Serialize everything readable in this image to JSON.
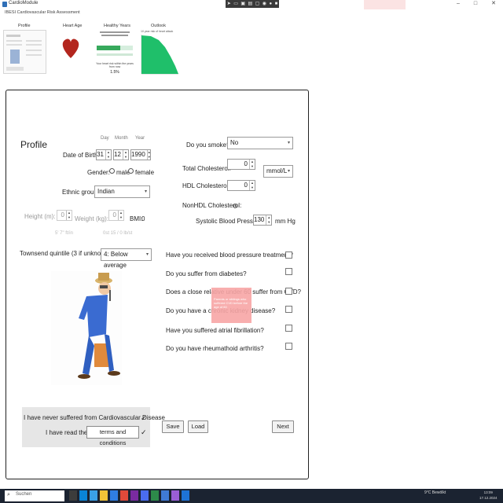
{
  "titlebar": {
    "app_title": "CardioModule",
    "toolbar_icons": [
      "cursor-icon",
      "window-icon",
      "highlight-icon",
      "folder-icon",
      "window-icon",
      "record-icon",
      "circle-icon",
      "stop-icon"
    ],
    "window_controls": {
      "minimize": "–",
      "maximize": "□",
      "close": "✕"
    }
  },
  "subtitle": "IBESI Cardiovascular Risk Assessment",
  "nav_tabs": [
    {
      "label": "Profile"
    },
    {
      "label": "Heart Age"
    },
    {
      "label": "Healthy Years"
    },
    {
      "label": "Outlook"
    }
  ],
  "thumb_healthy_years": {
    "desc": "Your heart risk within the years from now",
    "percent": "1.5%"
  },
  "thumb_outlook_title": "10 year risk of heart attack",
  "profile": {
    "heading": "Profile",
    "dob": {
      "label": "Date of Birth",
      "day_label": "Day",
      "month_label": "Month",
      "year_label": "Year",
      "day": "31",
      "month": "12",
      "year": "1990"
    },
    "gender": {
      "label": "Gender:",
      "male": "male",
      "female": "female"
    },
    "ethnic": {
      "label": "Ethnic group",
      "value": "Indian"
    },
    "height": {
      "label": "Height (m):",
      "value": "0",
      "hint": "5' 7\" ft/in"
    },
    "weight": {
      "label": "Weight (kg):",
      "value": "0",
      "hint": "0st 15 / 0 lb/st"
    },
    "bmi": {
      "label": "BMI:",
      "value": "0"
    },
    "townsend": {
      "label": "Townsend quintile (3 if unknown):",
      "value": "4: Below average"
    }
  },
  "clinical": {
    "smoke": {
      "label": "Do you smoke?",
      "value": "No"
    },
    "total_chol": {
      "label": "Total Cholesterol:",
      "value": "0"
    },
    "chol_unit": "mmol/L",
    "hdl": {
      "label": "HDL Cholesterol:",
      "value": "0"
    },
    "nonhdl": {
      "label": "NonHDL Cholesterol:",
      "value": "0"
    },
    "sbp": {
      "label": "Systolic Blood Pressure:",
      "value": "130",
      "unit": "mm Hg"
    }
  },
  "questions": [
    "Have you received blood pressure treatment?",
    "Do you suffer from diabetes?",
    "Does a close relative under 60 suffer from CVD?",
    "Do you have a chronic kidney disease?",
    "Have you suffered atrial fibrillation?",
    "Do you have rheumathoid arthritis?"
  ],
  "tooltip": "Parents or siblings who suffered CVD before the age of 60",
  "declarations": {
    "never_cvd": "I have never suffered from Cardiovascular Disease",
    "read_the": "I have read the",
    "terms": "terms and conditions",
    "tick": "✓"
  },
  "buttons": {
    "save": "Save",
    "load": "Load",
    "next": "Next"
  },
  "taskbar": {
    "search_placeholder": "Suchen",
    "weather": "9°C Bewölkt",
    "time": "13:09",
    "date": "17.12.2024"
  }
}
